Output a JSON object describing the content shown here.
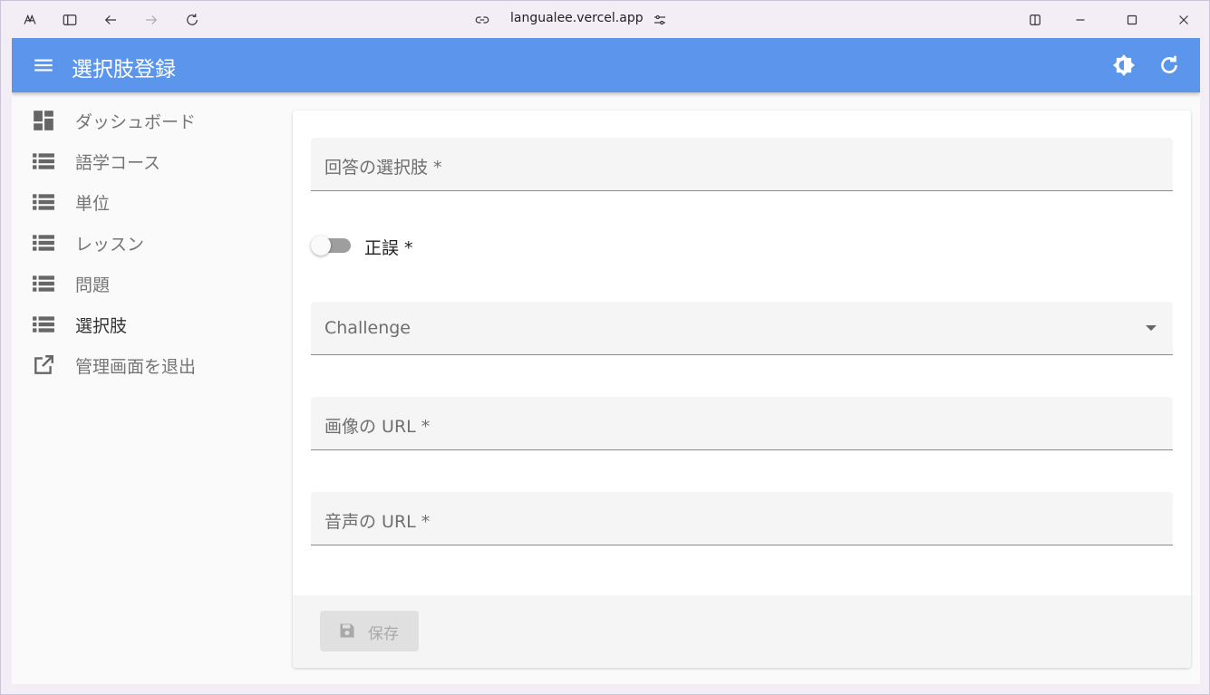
{
  "browser": {
    "url": "langualee.vercel.app",
    "icons": [
      "app-logo-icon",
      "sidebar-toggle-icon",
      "back-arrow-icon",
      "forward-arrow-icon",
      "reload-icon",
      "link-icon",
      "site-settings-icon",
      "split-view-icon",
      "minimize-icon",
      "maximize-icon",
      "close-icon"
    ]
  },
  "appbar": {
    "title": "選択肢登録",
    "color": "#5b96ec"
  },
  "sidebar": {
    "items": [
      {
        "label": "ダッシュボード",
        "icon": "dashboard-icon"
      },
      {
        "label": "語学コース",
        "icon": "list-icon"
      },
      {
        "label": "単位",
        "icon": "list-icon"
      },
      {
        "label": "レッスン",
        "icon": "list-icon"
      },
      {
        "label": "問題",
        "icon": "list-icon"
      },
      {
        "label": "選択肢",
        "icon": "list-icon",
        "active": true
      },
      {
        "label": "管理画面を退出",
        "icon": "open-external-icon"
      }
    ]
  },
  "form": {
    "answer_label": "回答の選択肢 *",
    "correct_label": "正誤 *",
    "correct_value": false,
    "challenge_label": "Challenge",
    "image_url_label": "画像の URL *",
    "audio_url_label": "音声の URL *",
    "save_label": "保存"
  }
}
